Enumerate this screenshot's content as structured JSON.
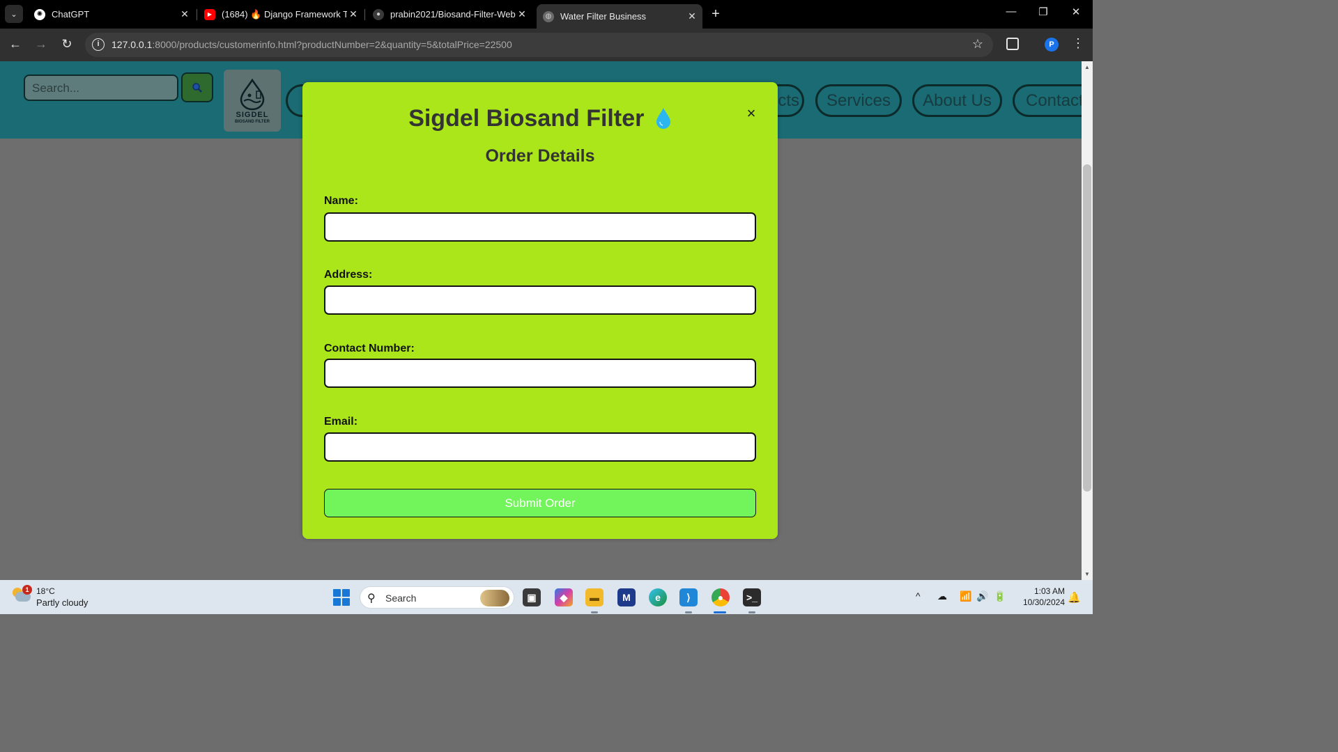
{
  "browser": {
    "tabs": [
      {
        "title": "ChatGPT",
        "icon": "chatgpt-icon"
      },
      {
        "title": "(1684) 🔥 Django Framework T",
        "icon": "youtube-icon"
      },
      {
        "title": "prabin2021/Biosand-Filter-Web",
        "icon": "github-icon"
      },
      {
        "title": "Water Filter Business",
        "icon": "globe-icon",
        "active": true
      }
    ],
    "tab_menu_glyph": "⌄",
    "close_glyph": "✕",
    "new_tab_glyph": "+",
    "window_controls": [
      "—",
      "❐",
      "✕"
    ],
    "url_host": "127.0.0.1",
    "url_rest": ":8000/products/customerinfo.html?productNumber=2&quantity=5&totalPrice=22500",
    "back_glyph": "←",
    "forward_glyph": "→",
    "reload_glyph": "↻",
    "info_glyph": "i",
    "star_glyph": "☆",
    "profile_initial": "P",
    "menu_glyph": "⋮"
  },
  "site": {
    "search_placeholder": "Search...",
    "logo_word": "SIGDEL",
    "logo_sub": "BIOSAND FILTER",
    "nav": [
      "cts",
      "Services",
      "About Us",
      "Contact"
    ]
  },
  "modal": {
    "title": "Sigdel Biosand Filter",
    "subtitle": "Order Details",
    "close_glyph": "×",
    "fields": [
      {
        "label": "Name:",
        "value": ""
      },
      {
        "label": "Address:",
        "value": ""
      },
      {
        "label": "Contact Number:",
        "value": ""
      },
      {
        "label": "Email:",
        "value": ""
      }
    ],
    "submit_label": "Submit Order",
    "colors": {
      "background": "#abe61b",
      "button": "#72f55b"
    }
  },
  "taskbar": {
    "weather_temp": "18°C",
    "weather_cond": "Partly cloudy",
    "weather_badge": "1",
    "search_label": "Search",
    "time": "1:03 AM",
    "date": "10/30/2024",
    "tray_glyphs": [
      "^",
      "☁",
      "📶",
      "🔊",
      "🔋"
    ],
    "bell_glyph": "🔔"
  }
}
